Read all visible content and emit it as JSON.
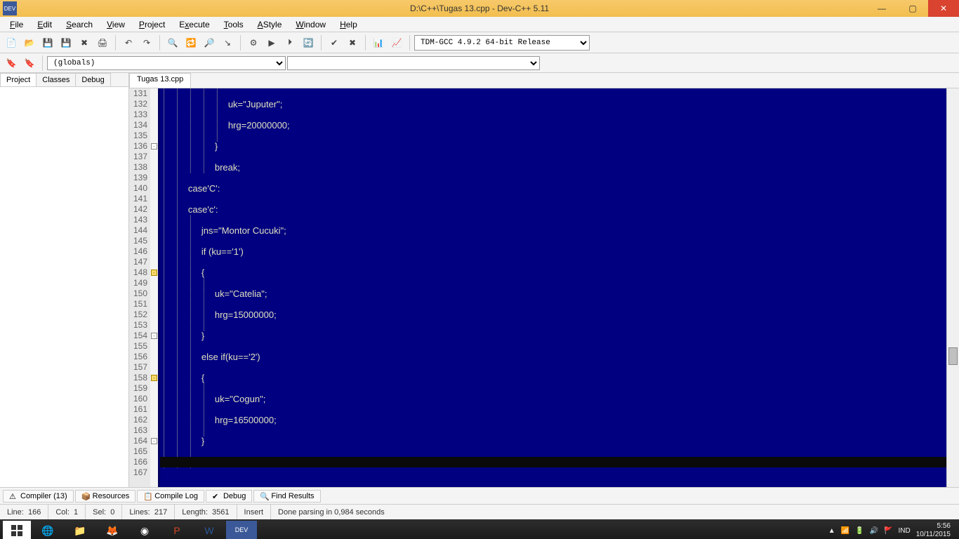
{
  "titlebar": {
    "title": "D:\\C++\\Tugas 13.cpp - Dev-C++ 5.11",
    "app_badge": "DEV"
  },
  "menu": [
    "File",
    "Edit",
    "Search",
    "View",
    "Project",
    "Execute",
    "Tools",
    "AStyle",
    "Window",
    "Help"
  ],
  "compiler_selector": "TDM-GCC 4.9.2 64-bit Release",
  "globals_selector": "(globals)",
  "sidebar_tabs": [
    "Project",
    "Classes",
    "Debug"
  ],
  "editor_tab": "Tugas 13.cpp",
  "code_lines": [
    {
      "n": 131,
      "t": "                    "
    },
    {
      "n": 132,
      "t": "                    uk=\"Juputer\";"
    },
    {
      "n": 133,
      "t": "                    "
    },
    {
      "n": 134,
      "t": "                    hrg=20000000;"
    },
    {
      "n": 135,
      "t": "                    "
    },
    {
      "n": 136,
      "t": "                }",
      "fold": "close"
    },
    {
      "n": 137,
      "t": "                "
    },
    {
      "n": 138,
      "t": "                break;"
    },
    {
      "n": 139,
      "t": "        "
    },
    {
      "n": 140,
      "t": "        case'C':"
    },
    {
      "n": 141,
      "t": "        "
    },
    {
      "n": 142,
      "t": "        case'c':"
    },
    {
      "n": 143,
      "t": "            "
    },
    {
      "n": 144,
      "t": "            jns=\"Montor Cucuki\";"
    },
    {
      "n": 145,
      "t": "            "
    },
    {
      "n": 146,
      "t": "            if (ku=='1')"
    },
    {
      "n": 147,
      "t": "            "
    },
    {
      "n": 148,
      "t": "            {",
      "fold": "open-y"
    },
    {
      "n": 149,
      "t": "                "
    },
    {
      "n": 150,
      "t": "                uk=\"Catelia\";"
    },
    {
      "n": 151,
      "t": "                "
    },
    {
      "n": 152,
      "t": "                hrg=15000000;"
    },
    {
      "n": 153,
      "t": "                "
    },
    {
      "n": 154,
      "t": "            }",
      "fold": "close"
    },
    {
      "n": 155,
      "t": "            "
    },
    {
      "n": 156,
      "t": "            else if(ku=='2')"
    },
    {
      "n": 157,
      "t": "            "
    },
    {
      "n": 158,
      "t": "            {",
      "fold": "open-y"
    },
    {
      "n": 159,
      "t": "                "
    },
    {
      "n": 160,
      "t": "                uk=\"Cogun\";"
    },
    {
      "n": 161,
      "t": "                "
    },
    {
      "n": 162,
      "t": "                hrg=16500000;"
    },
    {
      "n": 163,
      "t": "                "
    },
    {
      "n": 164,
      "t": "            }",
      "fold": "close"
    },
    {
      "n": 165,
      "t": "            "
    },
    {
      "n": 166,
      "t": "            else",
      "cursor": true
    },
    {
      "n": 167,
      "t": ""
    }
  ],
  "bottom_tabs": {
    "compiler": "Compiler (13)",
    "resources": "Resources",
    "compile_log": "Compile Log",
    "debug": "Debug",
    "find": "Find Results"
  },
  "status": {
    "line_lbl": "Line:",
    "line": "166",
    "col_lbl": "Col:",
    "col": "1",
    "sel_lbl": "Sel:",
    "sel": "0",
    "lines_lbl": "Lines:",
    "lines": "217",
    "length_lbl": "Length:",
    "length": "3561",
    "mode": "Insert",
    "msg": "Done parsing in 0,984 seconds"
  },
  "tray": {
    "lang": "IND",
    "time": "5:56",
    "date": "10/11/2015"
  }
}
